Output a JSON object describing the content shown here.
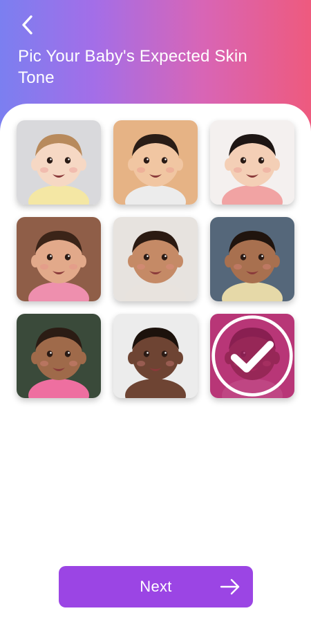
{
  "header": {
    "title": "Pic Your Baby's Expected Skin Tone",
    "back_icon": "chevron-left-icon",
    "gradient": [
      "#7b7ff0",
      "#a36ee8",
      "#d865b6",
      "#ee5a7e"
    ]
  },
  "skin_tones": [
    {
      "id": "tone-1",
      "bg": "#d9d9dc",
      "skin": "#f6d8c4",
      "hair": "#b88a5c",
      "shirt": "#f4e7a4",
      "selected": false
    },
    {
      "id": "tone-2",
      "bg": "#e6b385",
      "skin": "#f1c6a2",
      "hair": "#2a1d16",
      "shirt": "#ececec",
      "selected": false
    },
    {
      "id": "tone-3",
      "bg": "#f4f0ef",
      "skin": "#f4cfb6",
      "hair": "#1e1614",
      "shirt": "#f1a3a3",
      "selected": false
    },
    {
      "id": "tone-4",
      "bg": "#8f5e48",
      "skin": "#e2a98a",
      "hair": "#3b2418",
      "shirt": "#ee8fae",
      "selected": false
    },
    {
      "id": "tone-5",
      "bg": "#e7e3df",
      "skin": "#c58a66",
      "hair": "#2b1a12",
      "shirt": "#e8e3de",
      "selected": false
    },
    {
      "id": "tone-6",
      "bg": "#55677a",
      "skin": "#a8704f",
      "hair": "#20140e",
      "shirt": "#e6d9a8",
      "selected": false
    },
    {
      "id": "tone-7",
      "bg": "#3a4a3a",
      "skin": "#9f6a4a",
      "hair": "#2b1c14",
      "shirt": "#ee6fa0",
      "selected": false
    },
    {
      "id": "tone-8",
      "bg": "#ececec",
      "skin": "#6e4433",
      "hair": "#1c120c",
      "shirt": "#6e4433",
      "selected": false
    },
    {
      "id": "tone-9",
      "bg": "#d0689a",
      "skin": "#5a3428",
      "hair": "#2a1812",
      "shirt": "#e8a2c4",
      "selected": true
    }
  ],
  "selected_icon": "check-circle-icon",
  "next_button": {
    "label": "Next",
    "icon": "arrow-right-icon",
    "color": "#9b45e4"
  }
}
